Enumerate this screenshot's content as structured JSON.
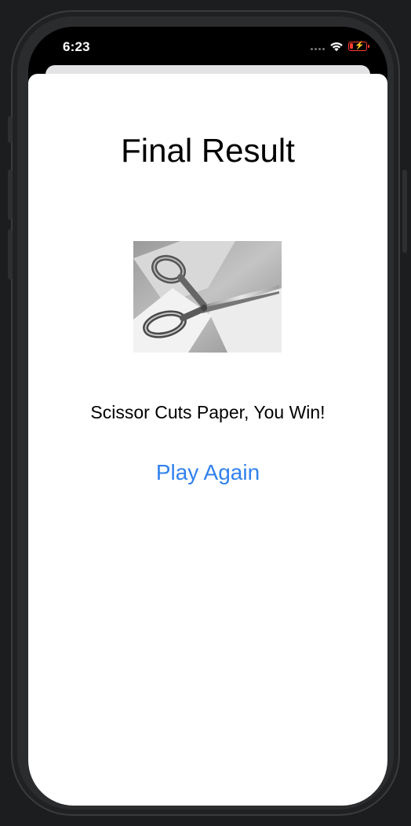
{
  "status_bar": {
    "time": "6:23",
    "battery_level": 0.2,
    "battery_charging": true,
    "icons": [
      "cellular-dots-icon",
      "wifi-icon",
      "battery-charging-icon"
    ]
  },
  "result_screen": {
    "title": "Final Result",
    "image_label": "scissors-cutting-paper",
    "result_text": "Scissor Cuts Paper, You Win!",
    "play_again_label": "Play Again"
  },
  "colors": {
    "accent": "#3182ec",
    "battery_low": "#ff3b30",
    "background": "#ffffff"
  }
}
